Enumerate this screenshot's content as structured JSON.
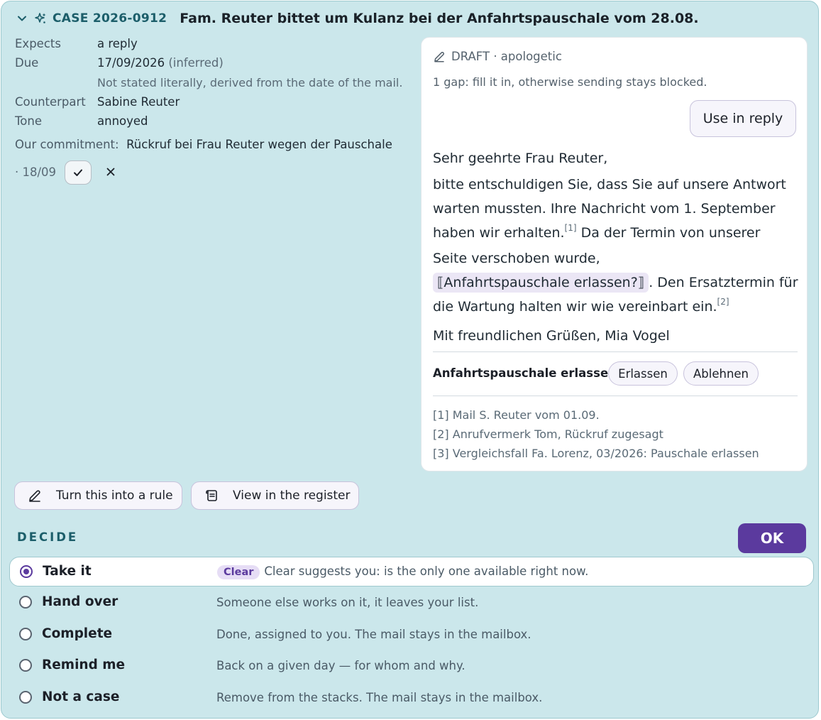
{
  "case": {
    "id": "CASE 2026-0912",
    "title": "Fam. Reuter bittet um Kulanz bei der Anfahrtspauschale vom 28.08."
  },
  "details": {
    "expects_label": "Expects",
    "expects_value": "a reply",
    "due_label": "Due",
    "due_value": "17/09/2026",
    "due_qualifier": "(inferred)",
    "due_note": "Not stated literally, derived from the date of the mail.",
    "counterpart_label": "Counterpart",
    "counterpart_value": "Sabine Reuter",
    "tone_label": "Tone",
    "tone_value": "annoyed",
    "commitment_label": "Our commitment:",
    "commitment_text": "Rückruf bei Frau Reuter wegen der Pauschale",
    "commitment_date": "· 18/09"
  },
  "draft": {
    "label": "DRAFT · apologetic",
    "gap_note": "1 gap: fill it in, otherwise sending stays blocked.",
    "use_button": "Use in reply",
    "salutation": "Sehr geehrte Frau Reuter,",
    "para_a": "bitte entschuldigen Sie, dass Sie auf unsere Antwort warten mussten. Ihre Nachricht vom 1. September haben wir erhalten.",
    "ref1": "[1]",
    "para_b": " Da der Termin von unserer Seite verschoben wurde, ",
    "gap_text": "⟦Anfahrtspauschale erlassen?⟧",
    "para_c": ". Den Ersatztermin für die Wartung halten wir wie vereinbart ein.",
    "ref2": "[2]",
    "closing": "Mit freundlichen Grüßen, Mia Vogel",
    "question": "Anfahrtspauschale erlassen?",
    "answer_yes": "Erlassen",
    "answer_no": "Ablehnen",
    "refs": [
      "[1] Mail S. Reuter vom 01.09.",
      "[2] Anrufvermerk Tom, Rückruf zugesagt",
      "[3] Vergleichsfall Fa. Lorenz, 03/2026: Pauschale erlassen"
    ]
  },
  "actions": {
    "rule_button": "Turn this into a rule",
    "register_button": "View in the register"
  },
  "decide": {
    "heading": "DECIDE",
    "ok_button": "OK",
    "options": [
      {
        "label": "Take it",
        "badge": "Clear",
        "desc": "Clear suggests you: is the only one available right now.",
        "selected": true
      },
      {
        "label": "Hand over",
        "desc": "Someone else works on it, it leaves your list.",
        "selected": false
      },
      {
        "label": "Complete",
        "desc": "Done, assigned to you. The mail stays in the mailbox.",
        "selected": false
      },
      {
        "label": "Remind me",
        "desc": "Back on a given day — for whom and why.",
        "selected": false
      },
      {
        "label": "Not a case",
        "desc": "Remove from the stacks. The mail stays in the mailbox.",
        "selected": false
      }
    ]
  },
  "colors": {
    "card_bg": "#cbe7eb",
    "accent": "#5b3a9e",
    "heading_teal": "#1c5e6a"
  }
}
